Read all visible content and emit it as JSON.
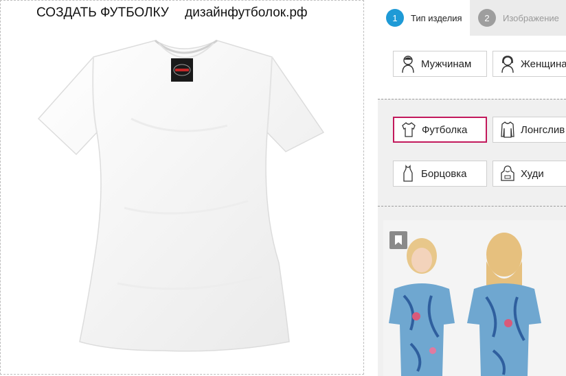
{
  "header": {
    "title": "СОЗДАТЬ ФУТБОЛКУ",
    "site": "дизайнфутболок.рф"
  },
  "tabs": [
    {
      "number": "1",
      "label": "Тип изделия",
      "active": true
    },
    {
      "number": "2",
      "label": "Изображение",
      "active": false
    }
  ],
  "gender": [
    {
      "label": "Мужчинам",
      "icon": "man-icon"
    },
    {
      "label": "Женщинам",
      "icon": "woman-icon"
    }
  ],
  "products": [
    {
      "label": "Футболка",
      "icon": "tshirt-icon",
      "selected": true
    },
    {
      "label": "Лонгслив",
      "icon": "longsleeve-icon",
      "selected": false
    },
    {
      "label": "Борцовка",
      "icon": "tanktop-icon",
      "selected": false
    },
    {
      "label": "Худи",
      "icon": "hoodie-icon",
      "selected": false
    }
  ],
  "colors": {
    "accent": "#1e9ad6",
    "selected_border": "#c2185b",
    "inactive_step": "#9e9e9e"
  }
}
